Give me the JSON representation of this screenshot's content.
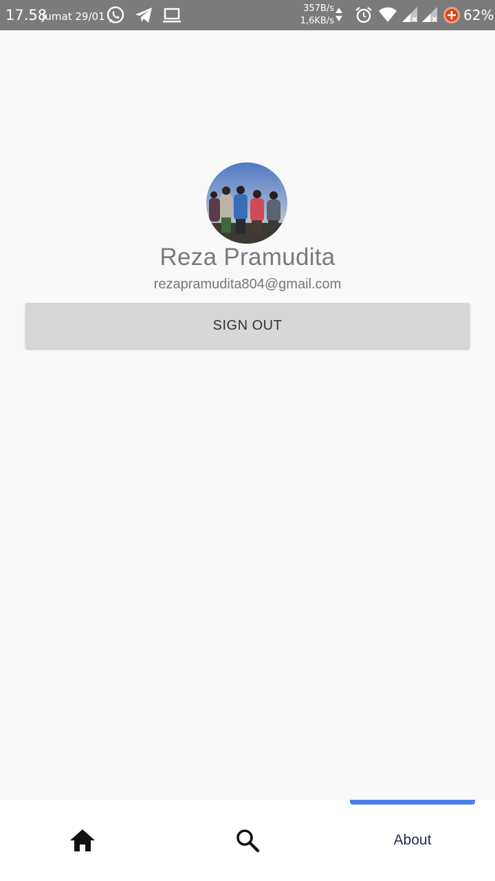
{
  "status_bar": {
    "time": "17.58",
    "date": "Jumat 29/01",
    "upload_speed": "357B/s",
    "download_speed": "1,6KB/s",
    "battery_percent": "62%",
    "icons": [
      "whatsapp-icon",
      "telegram-icon",
      "laptop-icon",
      "alarm-icon",
      "wifi-icon",
      "signal-icon",
      "signal-icon",
      "battery-saver-icon"
    ]
  },
  "profile": {
    "name": "Reza Pramudita",
    "email": "rezapramudita804@gmail.com",
    "sign_out_label": "SIGN OUT"
  },
  "bottom_nav": {
    "items": [
      {
        "icon": "home-icon"
      },
      {
        "icon": "search-icon"
      },
      {
        "label": "About",
        "active": true
      }
    ],
    "accent_color": "#4a7ef0"
  },
  "colors": {
    "status_bar_bg": "#7b7b7b",
    "page_bg": "#f9f9f9",
    "button_bg": "#d6d7d7"
  }
}
